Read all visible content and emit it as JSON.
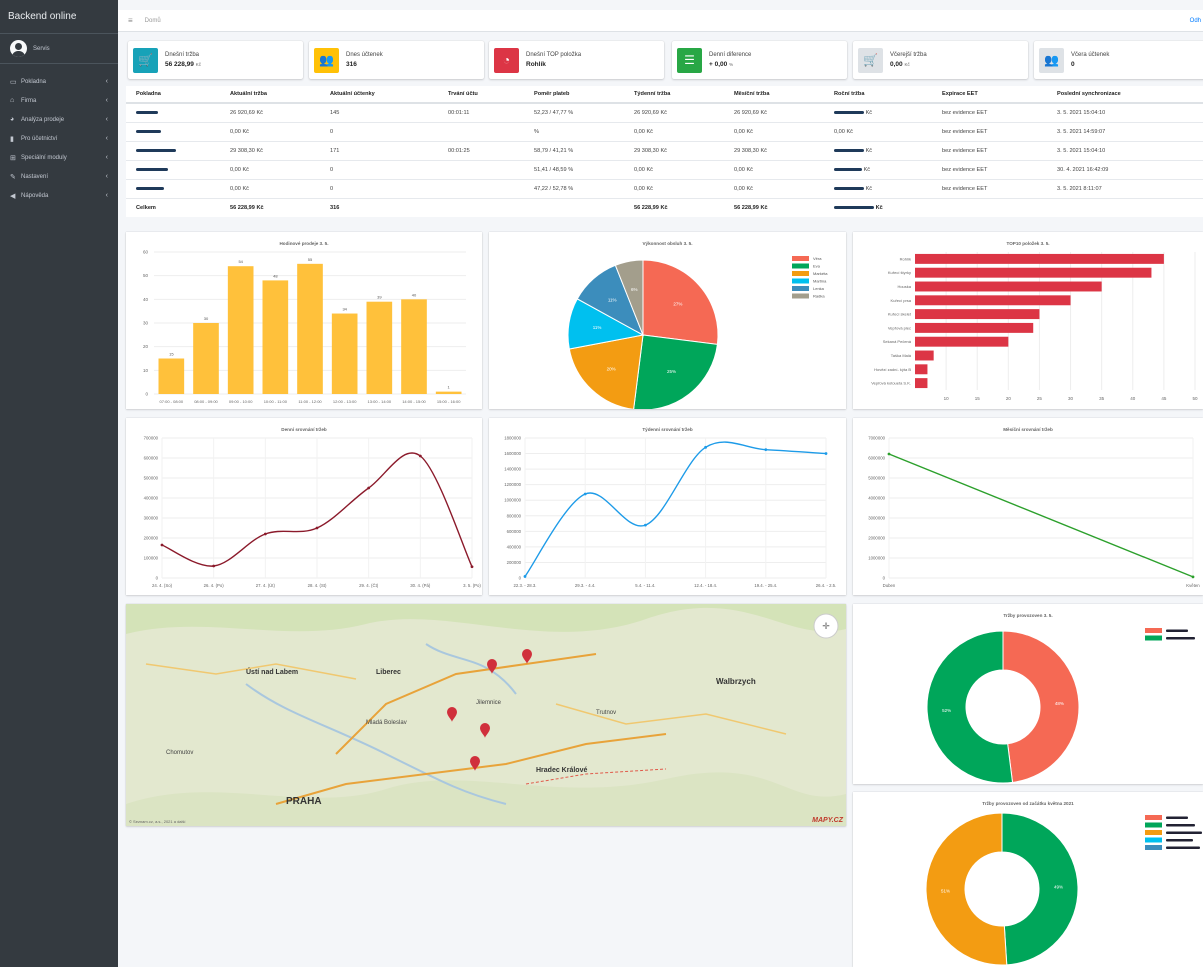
{
  "brand": "Backend online",
  "user": {
    "name": "Servis"
  },
  "sidebar": {
    "items": [
      {
        "label": "Pokladna",
        "icon": "monitor-icon"
      },
      {
        "label": "Firma",
        "icon": "home-icon"
      },
      {
        "label": "Analýza prodeje",
        "icon": "pie-icon"
      },
      {
        "label": "Pro účetnictví",
        "icon": "book-icon"
      },
      {
        "label": "Speciální moduly",
        "icon": "module-icon"
      },
      {
        "label": "Nastavení",
        "icon": "wrench-icon"
      },
      {
        "label": "Nápověda",
        "icon": "megaphone-icon"
      }
    ]
  },
  "topbar": {
    "breadcrumb": "Domů",
    "logout": "Odh"
  },
  "info_boxes": [
    {
      "label": "Dnešní tržba",
      "value": "56 228,99",
      "unit": "Kč",
      "color": "#17a2b8",
      "icon": "cart-icon",
      "glyph": "🛒"
    },
    {
      "label": "Dnes účtenek",
      "value": "316",
      "unit": "",
      "color": "#ffc107",
      "icon": "users-icon",
      "glyph": "👥"
    },
    {
      "label": "Dnešní TOP položka",
      "value": "Rohlík",
      "unit": "",
      "color": "#dc3545",
      "icon": "pie-chart-icon",
      "glyph": "◔"
    },
    {
      "label": "Denní diference",
      "value": "+ 0,00",
      "unit": "%",
      "color": "#28a745",
      "icon": "list-icon",
      "glyph": "☰"
    },
    {
      "label": "Včerejší tržba",
      "value": "0,00",
      "unit": "Kč",
      "color": "#dee2e6",
      "icon": "cart-icon",
      "glyph": "🛒"
    },
    {
      "label": "Včera účtenek",
      "value": "0",
      "unit": "",
      "color": "#dee2e6",
      "icon": "users-icon",
      "glyph": "👥"
    }
  ],
  "table": {
    "headers": [
      "Pokladna",
      "Aktuální tržba",
      "Aktuální účtenky",
      "Trvání účtu",
      "Poměr plateb",
      "Týdenní tržba",
      "Měsíční tržba",
      "Roční tržba",
      "Expirace EET",
      "Poslední synchronizace"
    ],
    "rows": [
      [
        "",
        "26 920,69 Kč",
        "145",
        "00:01:11",
        "52,23 / 47,77 %",
        "26 920,69 Kč",
        "26 920,69 Kč",
        "Kč",
        "bez evidence EET",
        "3. 5. 2021 15:04:10"
      ],
      [
        "",
        "0,00 Kč",
        "0",
        "",
        "%",
        "0,00 Kč",
        "0,00 Kč",
        "0,00 Kč",
        "bez evidence EET",
        "3. 5. 2021 14:59:07"
      ],
      [
        "",
        "29 308,30 Kč",
        "171",
        "00:01:25",
        "58,79 / 41,21 %",
        "29 308,30 Kč",
        "29 308,30 Kč",
        "Kč",
        "bez evidence EET",
        "3. 5. 2021 15:04:10"
      ],
      [
        "",
        "0,00 Kč",
        "0",
        "",
        "51,41 / 48,59 %",
        "0,00 Kč",
        "0,00 Kč",
        "Kč",
        "bez evidence EET",
        "30. 4. 2021 16:42:09"
      ],
      [
        "",
        "0,00 Kč",
        "0",
        "",
        "47,22 / 52,78 %",
        "0,00 Kč",
        "0,00 Kč",
        "Kč",
        "bez evidence EET",
        "3. 5. 2021 8:11:07"
      ]
    ],
    "total": [
      "Celkem",
      "56 228,99 Kč",
      "316",
      "",
      "",
      "56 228,99 Kč",
      "56 228,99 Kč",
      "Kč",
      "",
      ""
    ]
  },
  "map": {
    "logo": "MAPY.CZ",
    "copyright": "© Seznam.cz, a.s., 2021 a další"
  },
  "chart_data": [
    {
      "type": "bar",
      "title": "Hodinové prodeje 3. 5.",
      "categories": [
        "07:00 - 08:00",
        "08:00 - 09:00",
        "09:00 - 10:00",
        "10:00 - 11:00",
        "11:00 - 12:00",
        "12:00 - 13:00",
        "13:00 - 14:00",
        "14:00 - 15:00",
        "15:00 - 16:00"
      ],
      "values": [
        15,
        30,
        54,
        48,
        55,
        34,
        39,
        40,
        1
      ],
      "ylim": [
        0,
        60
      ],
      "color": "#ffc13b"
    },
    {
      "type": "pie",
      "title": "Výkonnost obsluh 3. 5.",
      "slices": [
        {
          "name": "Věra",
          "value": 27,
          "label": "27%",
          "color": "#f56954"
        },
        {
          "name": "Eva",
          "value": 25,
          "label": "25%",
          "color": "#00a65a"
        },
        {
          "name": "Markéta",
          "value": 20,
          "label": "20%",
          "color": "#f39c12"
        },
        {
          "name": "Martina",
          "value": 11,
          "label": "11%",
          "color": "#00c0ef"
        },
        {
          "name": "Lenka",
          "value": 11,
          "label": "11%",
          "color": "#3c8dbc"
        },
        {
          "name": "Radka",
          "value": 6,
          "label": "6%",
          "color": "#a39e8c"
        }
      ]
    },
    {
      "type": "bar",
      "title": "TOP10 položek 3. 5.",
      "categories": [
        "Rohlík",
        "Kuřecí štyrky",
        "Houska",
        "Kuřecí prsa",
        "Kuřecí skelet",
        "Vepřová plec",
        "Sekaná Pečená",
        "Taška Malá",
        "Hovězí zadní- kýta B",
        "Vepřová kotoueta S.K."
      ],
      "values": [
        45,
        43,
        35,
        30,
        25,
        24,
        20,
        8,
        7,
        7
      ],
      "xlim": [
        5,
        50
      ],
      "xticks": [
        10,
        15,
        20,
        25,
        30,
        35,
        40,
        45,
        50
      ],
      "color": "#dc3545"
    },
    {
      "type": "line",
      "title": "Denní srovnání tržeb",
      "x": [
        "24. 4. (So)",
        "26. 4. (Po)",
        "27. 4. (Út)",
        "28. 4. (St)",
        "29. 4. (Čt)",
        "30. 4. (Pá)",
        "3. 5. (Po)"
      ],
      "values": [
        165000,
        60000,
        220000,
        250000,
        450000,
        610000,
        56229
      ],
      "ylim": [
        0,
        700000
      ],
      "color": "#8b1a2b"
    },
    {
      "type": "line",
      "title": "Týdenní srovnání tržeb",
      "x": [
        "22.3. - 28.3.",
        "29.3. - 4.4.",
        "5.4. - 11.4.",
        "12.4. - 18.4.",
        "19.4. - 25.4.",
        "26.4. - 2.5."
      ],
      "values": [
        20000,
        1080000,
        680000,
        1680000,
        1650000,
        1600000
      ],
      "ylim": [
        0,
        1800000
      ],
      "color": "#1d9be8"
    },
    {
      "type": "line",
      "title": "Měsíční srovnání tržeb",
      "x": [
        "Duben",
        "Květen"
      ],
      "values": [
        6200000,
        56229
      ],
      "ylim": [
        0,
        7000000
      ],
      "color": "#2ca02c"
    },
    {
      "type": "pie",
      "title": "Tržby provozoven 3. 5.",
      "slices": [
        {
          "name": "",
          "value": 48,
          "label": "48%",
          "color": "#f56954"
        },
        {
          "name": "",
          "value": 52,
          "label": "52%",
          "color": "#00a65a"
        }
      ]
    },
    {
      "type": "pie",
      "title": "Tržby provozoven od začátku května 2021",
      "slices": [
        {
          "name": "",
          "value": 0,
          "label": "",
          "color": "#f56954"
        },
        {
          "name": "",
          "value": 49,
          "label": "49%",
          "color": "#00a65a"
        },
        {
          "name": "",
          "value": 51,
          "label": "51%",
          "color": "#f39c12"
        },
        {
          "name": "",
          "value": 0,
          "label": "",
          "color": "#00c0ef"
        },
        {
          "name": "",
          "value": 0,
          "label": "",
          "color": "#3c8dbc"
        }
      ]
    }
  ]
}
